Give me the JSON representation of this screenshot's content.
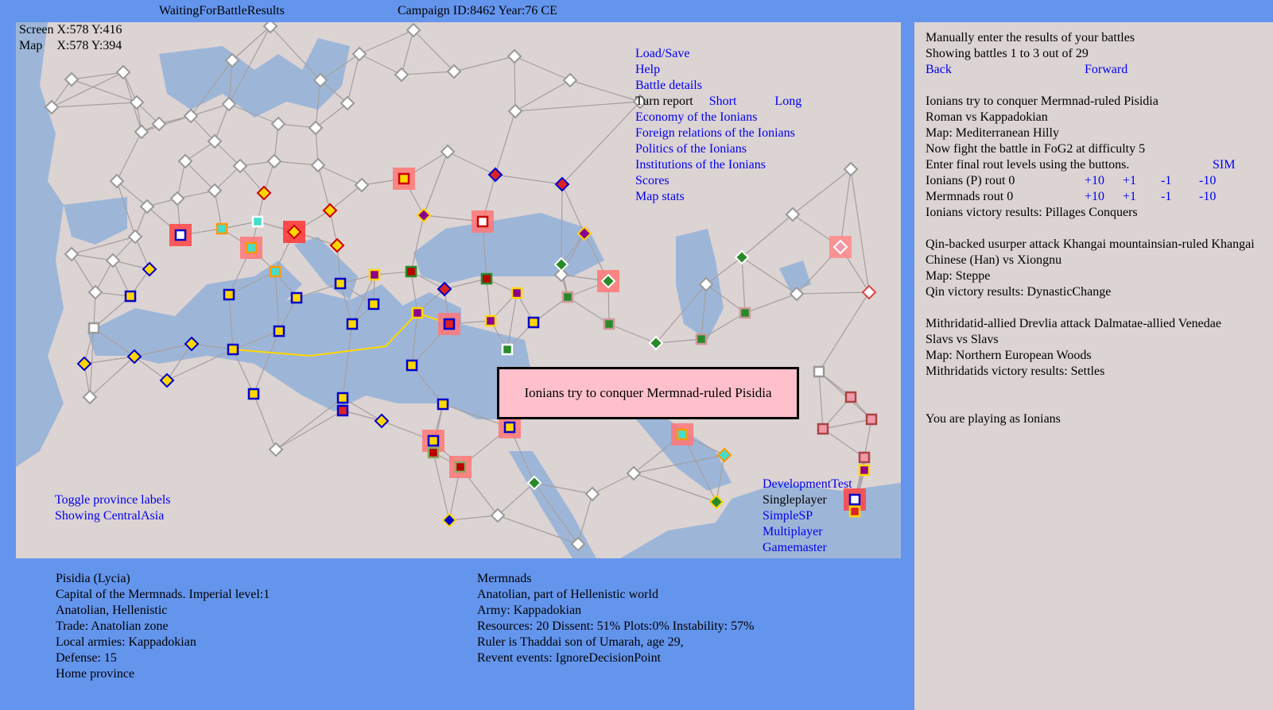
{
  "header": {
    "status": "WaitingForBattleResults",
    "campaign": "Campaign ID:8462 Year:76 CE"
  },
  "coords": {
    "screen": "Screen X:578 Y:416",
    "map_label": "Map",
    "map_value": "X:578 Y:394"
  },
  "map_menu": {
    "load_save": "Load/Save",
    "help": "Help",
    "battle_details": "Battle details",
    "turn_report": "Turn report",
    "short": "Short",
    "long": "Long",
    "economy": "Economy of the Ionians",
    "foreign": "Foreign relations of the Ionians",
    "politics": "Politics of the Ionians",
    "institutions": "Institutions of the Ionians",
    "scores": "Scores",
    "map_stats": "Map stats"
  },
  "map_bottom_left": {
    "toggle_labels": "Toggle province labels",
    "showing": "Showing CentralAsia"
  },
  "mode_menu": {
    "development_test": "DevelopmentTest",
    "singleplayer": "Singleplayer",
    "simple_sp": "SimpleSP",
    "multiplayer": "Multiplayer",
    "gamemaster": "Gamemaster"
  },
  "popup": {
    "text": "Ionians try to conquer Mermnad-ruled Pisidia"
  },
  "province_info": {
    "name": "Pisidia (Lycia)",
    "capital": "Capital of the Mermnads. Imperial level:1",
    "culture": "Anatolian, Hellenistic",
    "trade": "Trade: Anatolian zone",
    "armies": "Local armies: Kappadokian",
    "defense": "Defense: 15",
    "home": "Home province"
  },
  "faction_info": {
    "name": "Mermnads",
    "culture": "Anatolian, part of Hellenistic world",
    "army": "Army: Kappadokian",
    "resources": "Resources: 20 Dissent: 51% Plots:0% Instability: 57%",
    "ruler": "Ruler is Thaddai son of Umarah, age 29,",
    "events": "Revent events: IgnoreDecisionPoint"
  },
  "battles_panel": {
    "intro": "Manually enter the results of your battles",
    "showing": "Showing battles 1 to 3 out of 29",
    "back": "Back",
    "forward": "Forward",
    "battle1": {
      "title": "Ionians try to conquer Mermnad-ruled Pisidia",
      "armies": "Roman vs Kappadokian",
      "map": "Map: Mediterranean Hilly",
      "difficulty": "Now fight the battle in FoG2 at difficulty 5",
      "instructions": "Enter final rout levels using the buttons.",
      "sim": "SIM",
      "rout_rows": [
        {
          "label": "Ionians (P) rout 0",
          "p10": "+10",
          "p1": "+1",
          "m1": "-1",
          "m10": "-10"
        },
        {
          "label": "Mermnads rout 0",
          "p10": "+10",
          "p1": "+1",
          "m1": "-1",
          "m10": "-10"
        }
      ],
      "victory": "Ionians victory results: Pillages Conquers"
    },
    "battle2": {
      "title": "Qin-backed usurper attack Khangai mountainsian-ruled Khangai",
      "armies": "Chinese (Han) vs Xiongnu",
      "map": "Map: Steppe",
      "victory": "Qin victory results: DynasticChange"
    },
    "battle3": {
      "title": "Mithridatid-allied Drevlia attack Dalmatae-allied Venedae",
      "armies": "Slavs vs Slavs",
      "map": "Map: Northern European Woods",
      "victory": "Mithridatids victory results: Settles"
    },
    "playing_as": "You are playing as Ionians"
  },
  "colors": {
    "background": "#6495ED",
    "panel": "#DCD3D3",
    "sea": "#9DB6D8",
    "link": "#0000EE",
    "route": "#FFD700",
    "popup": "#FFC0CB"
  }
}
